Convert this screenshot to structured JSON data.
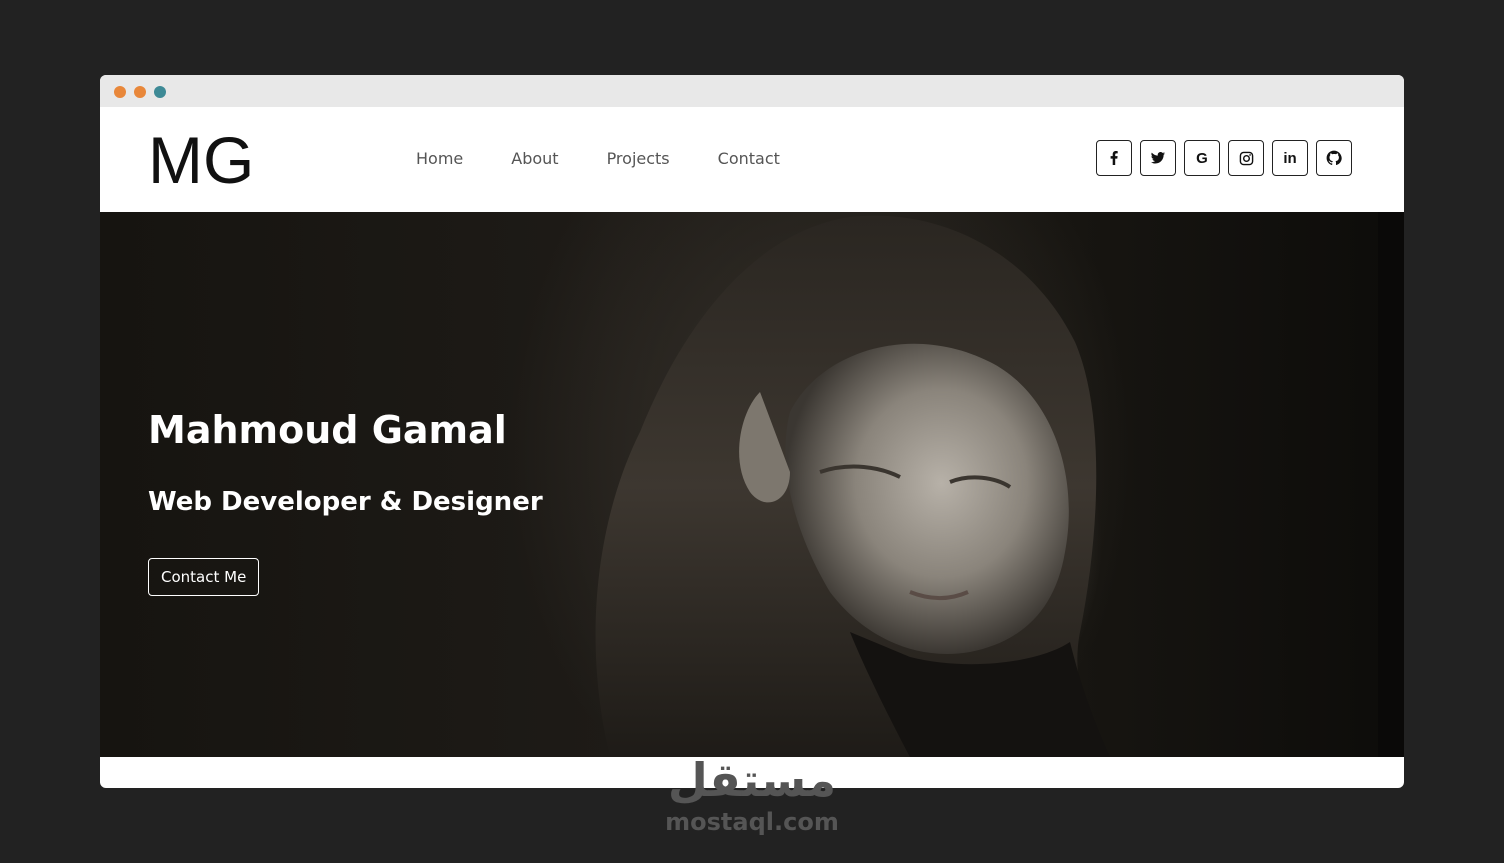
{
  "window": {
    "dots": [
      "#e8873a",
      "#e8873a",
      "#3e8a96"
    ]
  },
  "navbar": {
    "logo": "MG",
    "links": [
      "Home",
      "About",
      "Projects",
      "Contact"
    ],
    "socials": [
      {
        "name": "facebook-icon"
      },
      {
        "name": "twitter-icon"
      },
      {
        "name": "google-icon",
        "glyph": "G"
      },
      {
        "name": "instagram-icon"
      },
      {
        "name": "linkedin-icon",
        "glyph": "in"
      },
      {
        "name": "github-icon"
      }
    ]
  },
  "hero": {
    "title": "Mahmoud Gamal",
    "subtitle": "Web Developer & Designer",
    "button_label": "Contact Me"
  },
  "watermark": {
    "arabic": "مستقل",
    "latin": "mostaql.com"
  }
}
